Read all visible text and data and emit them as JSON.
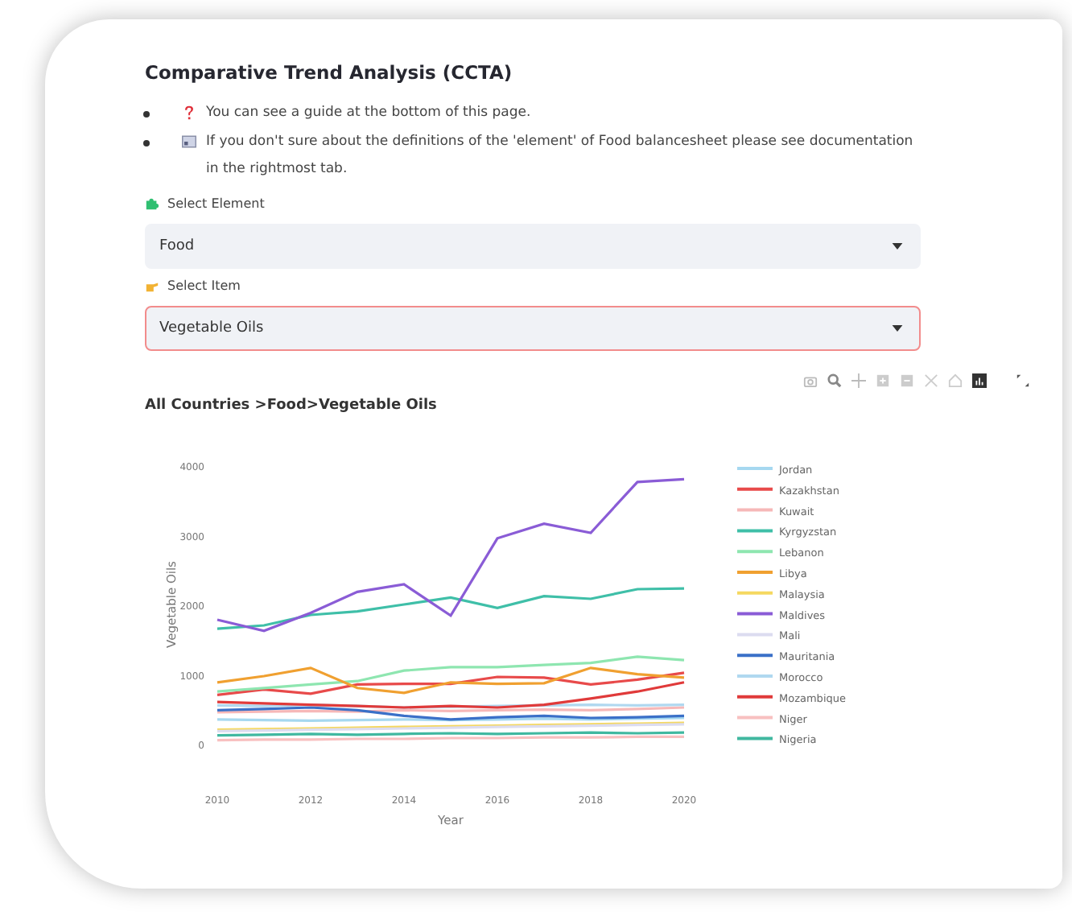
{
  "heading": "Comparative Trend Analysis (CCTA)",
  "notes": [
    {
      "text": "You can see a guide at the bottom of this page."
    },
    {
      "text": "If you don't sure about the definitions of the 'element' of Food balancesheet please see documentation in the rightmost tab."
    }
  ],
  "selects": [
    {
      "label": "Select Element",
      "value": "Food",
      "focused": false
    },
    {
      "label": "Select Item",
      "value": "Vegetable Oils",
      "focused": true
    }
  ],
  "chart": {
    "title": "All Countries >Food>Vegetable Oils",
    "chart_data": {
      "type": "line",
      "xlabel": "Year",
      "ylabel": "Vegetable Oils",
      "x": [
        2010,
        2011,
        2012,
        2013,
        2014,
        2015,
        2016,
        2017,
        2018,
        2019,
        2020
      ],
      "xticks": [
        2010,
        2012,
        2014,
        2016,
        2018,
        2020
      ],
      "yticks": [
        0,
        1000,
        2000,
        3000,
        4000
      ],
      "xlim": [
        2010,
        2020
      ],
      "ylim": [
        0,
        4000
      ],
      "legend": "right",
      "series": [
        {
          "name": "Jordan",
          "color": "#a6d8f0",
          "values": [
            350,
            340,
            330,
            340,
            350,
            340,
            350,
            360,
            350,
            360,
            370
          ]
        },
        {
          "name": "Kazakhstan",
          "color": "#e84a4a",
          "values": [
            700,
            780,
            720,
            850,
            860,
            860,
            960,
            950,
            850,
            920,
            1020
          ]
        },
        {
          "name": "Kuwait",
          "color": "#f6b8b8",
          "values": [
            450,
            460,
            470,
            460,
            480,
            470,
            480,
            490,
            480,
            500,
            520
          ]
        },
        {
          "name": "Kyrgyzstan",
          "color": "#3fbfa8",
          "values": [
            1650,
            1700,
            1850,
            1900,
            2000,
            2100,
            1950,
            2120,
            2080,
            2220,
            2230
          ]
        },
        {
          "name": "Lebanon",
          "color": "#8ee6b0",
          "values": [
            750,
            800,
            850,
            900,
            1050,
            1100,
            1100,
            1130,
            1160,
            1250,
            1200
          ]
        },
        {
          "name": "Libya",
          "color": "#f0a030",
          "values": [
            880,
            970,
            1090,
            800,
            730,
            880,
            860,
            870,
            1090,
            1000,
            950
          ]
        },
        {
          "name": "Malaysia",
          "color": "#f5d860",
          "values": [
            200,
            210,
            220,
            230,
            240,
            250,
            260,
            270,
            280,
            290,
            300
          ]
        },
        {
          "name": "Maldives",
          "color": "#8a5cd6",
          "values": [
            1780,
            1620,
            1880,
            2180,
            2290,
            1840,
            2950,
            3160,
            3030,
            3760,
            3800
          ]
        },
        {
          "name": "Mali",
          "color": "#dcdcf0",
          "values": [
            180,
            190,
            200,
            210,
            220,
            230,
            240,
            250,
            260,
            270,
            280
          ]
        },
        {
          "name": "Mauritania",
          "color": "#3a70c8",
          "values": [
            480,
            500,
            520,
            480,
            400,
            350,
            380,
            400,
            370,
            380,
            400
          ]
        },
        {
          "name": "Morocco",
          "color": "#b0d8f0",
          "values": [
            550,
            540,
            560,
            540,
            520,
            530,
            540,
            550,
            560,
            550,
            560
          ]
        },
        {
          "name": "Mozambique",
          "color": "#e03a3a",
          "values": [
            600,
            580,
            560,
            540,
            520,
            540,
            520,
            560,
            650,
            750,
            880
          ]
        },
        {
          "name": "Niger",
          "color": "#f8c0c0",
          "values": [
            50,
            60,
            60,
            70,
            70,
            80,
            80,
            90,
            90,
            100,
            100
          ]
        },
        {
          "name": "Nigeria",
          "color": "#40b8a0",
          "values": [
            120,
            130,
            140,
            130,
            140,
            150,
            140,
            150,
            160,
            150,
            160
          ]
        }
      ]
    }
  }
}
